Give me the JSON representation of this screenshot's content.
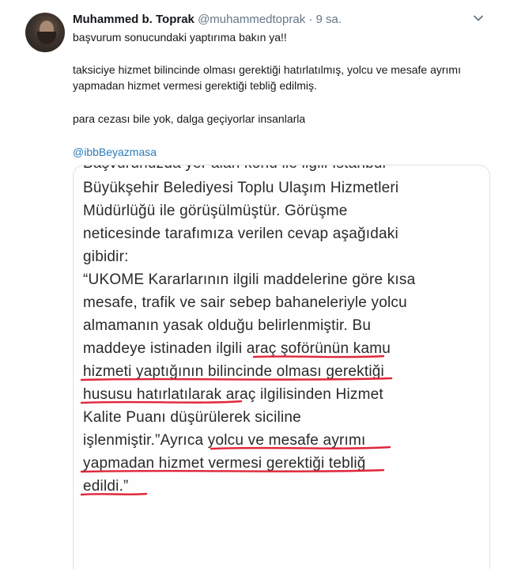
{
  "tweet": {
    "display_name": "Muhammed b. Toprak",
    "handle": "@muhammedtoprak",
    "separator": " · ",
    "time": "9 sa.",
    "paragraphs": [
      "başvurum sonucundaki yaptırıma bakın ya!!",
      "taksiciye hizmet bilincinde olması gerektiği hatırlatılmış, yolcu ve mesafe ayrımı",
      "yapmadan hizmet vermesi gerektiği tebliğ edilmiş.",
      "para cezası bile yok, dalga geçiyorlar insanlarla"
    ],
    "mention": "@ibbBeyazmasa"
  },
  "icons": {
    "avatar": "user-photo",
    "menu": "chevron-down-icon"
  },
  "colors": {
    "link": "#2b7bb9",
    "underline": "#e0263a",
    "muted": "#657786"
  },
  "document": {
    "cut_line": "Başvurunuzda yer alan konu ile ilgili İstanbul",
    "lines": [
      "Büyükşehir Belediyesi Toplu Ulaşım Hizmetleri",
      "Müdürlüğü ile görüşülmüştür. Görüşme",
      "neticesinde tarafımıza verilen cevap aşağıdaki",
      "gibidir:",
      "“UKOME Kararlarının ilgili maddelerine göre kısa",
      "mesafe,  trafik ve sair sebep bahaneleriyle yolcu",
      "almamanın yasak olduğu belirlenmiştir. Bu",
      "maddeye istinaden ilgili araç şoförünün kamu",
      "hizmeti yaptığının bilincinde olması gerektiği",
      "hususu hatırlatılarak araç ilgilisinden Hizmet",
      "Kalite Puanı düşürülerek siciline",
      "işlenmiştir.”Ayrıca  yolcu ve mesafe ayrımı",
      "yapmadan hizmet vermesi gerektiği tebliğ",
      "edildi.”"
    ]
  }
}
